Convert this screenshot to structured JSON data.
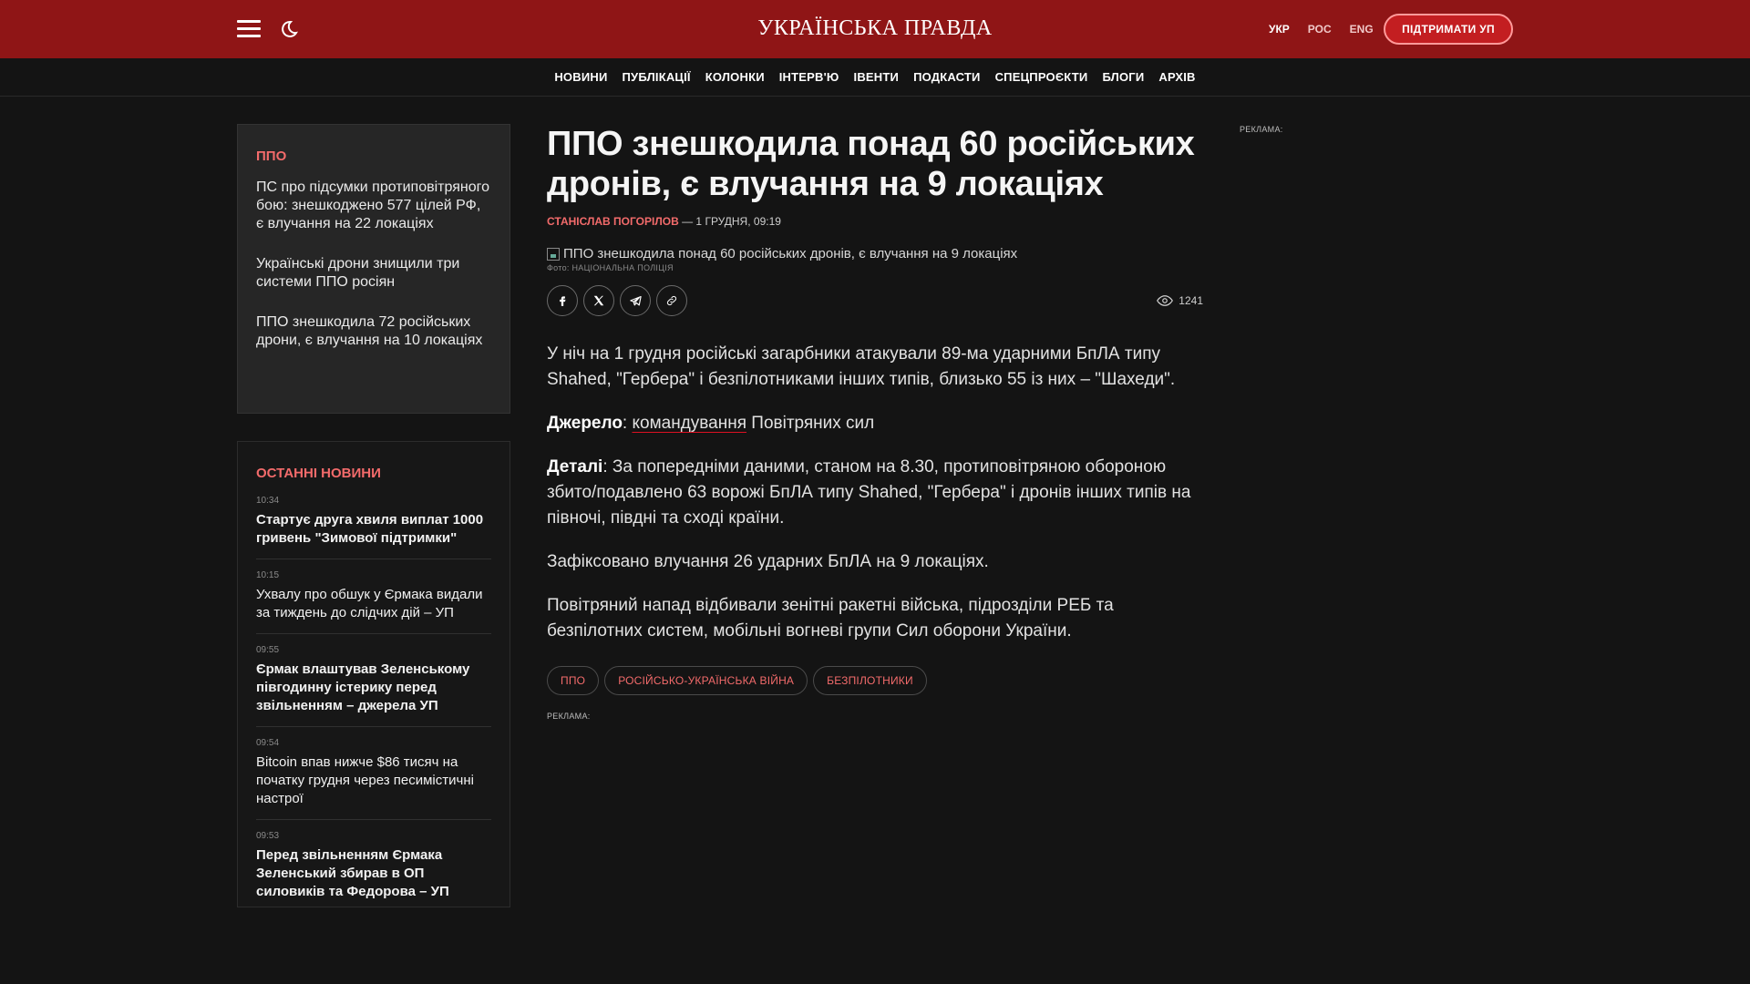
{
  "header": {
    "logo": "УКРАЇНСЬКА ПРАВДА",
    "languages": [
      "УКР",
      "РОС",
      "ENG"
    ],
    "active_language": "УКР",
    "support_button": "ПІДТРИМАТИ УП",
    "colors": {
      "bar": "#8f1516",
      "accent": "#f36b6b"
    },
    "icons": [
      "menu-icon",
      "moon-icon"
    ]
  },
  "nav": [
    "НОВИНИ",
    "ПУБЛІКАЦІЇ",
    "КОЛОНКИ",
    "ІНТЕРВ'Ю",
    "ІВЕНТИ",
    "ПОДКАСТИ",
    "СПЕЦПРОЄКТИ",
    "БЛОГИ",
    "АРХІВ"
  ],
  "topic": {
    "tag": "ППО",
    "items": [
      "ПС про підсумки протиповітряного бою: знешкоджено 577 цілей РФ, є влучання на 22 локаціях",
      "Українські дрони знищили три системи ППО росіян",
      "ППО знешкодила 72 російських дрони, є влучання на 10 локаціях"
    ]
  },
  "latest": {
    "heading": "ОСТАННІ НОВИНИ",
    "items": [
      {
        "time": "10:34",
        "title": "Стартує друга хвиля виплат 1000 гривень \"Зимової підтримки\""
      },
      {
        "time": "10:15",
        "title": "Ухвалу про обшук у Єрмака видали за тиждень до слідчих дій – УП"
      },
      {
        "time": "09:55",
        "title": "Єрмак влаштував Зеленському півгодинну істерику перед звільненням – джерела УП"
      },
      {
        "time": "09:54",
        "title": "Bitcoin впав нижче $86 тисяч на початку грудня через песимістичні настрої"
      },
      {
        "time": "09:53",
        "title": "Перед звільненням Єрмака Зеленський збирав в ОП силовиків та Федорова – УП"
      }
    ]
  },
  "article": {
    "title": "ППО знешкодила понад 60 російських дронів, є влучання на 9 локаціях",
    "author": "СТАНІСЛАВ ПОГОРІЛОВ",
    "date": " — 1 ГРУДНЯ, 09:19",
    "image_alt": "ППО знешкодила понад 60 російських дронів, є влучання на 9 локаціях",
    "photo_credit": "Фото: НАЦІОНАЛЬНА ПОЛІЦІЯ",
    "share_icons": [
      "facebook-icon",
      "x-icon",
      "telegram-icon",
      "link-icon"
    ],
    "views": "1241",
    "p1": "У ніч на 1 грудня російські загарбники атакували 89-ма ударними БпЛА типу Shahed, \"Гербера\" і безпілотниками інших типів, близько 55 із них – \"Шахеди\".",
    "source_label": "Джерело",
    "source_sep": ": ",
    "source_link": "командування",
    "source_rest": " Повітряних сил",
    "details_label": "Деталі",
    "details_text": ": За попередніми даними, станом на 8.30, протиповітряною обороною збито/подавлено 63 ворожі БпЛА типу Shahed, \"Гербера\" і дронів інших типів на півночі, півдні та сході країни.",
    "p4": "Зафіксовано влучання 26 ударних БпЛА на 9 локаціях.",
    "p5": "Повітряний напад відбивали зенітні ракетні війська, підрозділи РЕБ та безпілотних систем, мобільні вогневі групи Сил оборони України.",
    "tags": [
      "ППО",
      "РОСІЙСЬКО-УКРАЇНСЬКА ВІЙНА",
      "БЕЗПІЛОТНИКИ"
    ]
  },
  "ads": {
    "label": "РЕКЛАМА:"
  }
}
